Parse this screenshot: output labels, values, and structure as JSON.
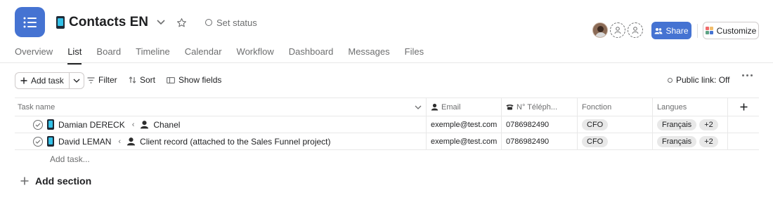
{
  "header": {
    "project_title": "Contacts EN",
    "set_status": "Set status",
    "share_label": "Share",
    "customize_label": "Customize",
    "accent_color": "#4573d2"
  },
  "tabs": [
    {
      "label": "Overview",
      "active": false
    },
    {
      "label": "List",
      "active": true
    },
    {
      "label": "Board",
      "active": false
    },
    {
      "label": "Timeline",
      "active": false
    },
    {
      "label": "Calendar",
      "active": false
    },
    {
      "label": "Workflow",
      "active": false
    },
    {
      "label": "Dashboard",
      "active": false
    },
    {
      "label": "Messages",
      "active": false
    },
    {
      "label": "Files",
      "active": false
    }
  ],
  "toolbar": {
    "add_task": "Add task",
    "filter": "Filter",
    "sort": "Sort",
    "show_fields": "Show fields",
    "public_link": "Public link: Off"
  },
  "table": {
    "columns": [
      "Task name",
      "Email",
      "N° Téléph...",
      "Fonction",
      "Langues"
    ],
    "rows": [
      {
        "name": "Damian DERECK",
        "parent": "Chanel",
        "email": "exemple@test.com",
        "phone": "0786982490",
        "fonction": "CFO",
        "langue": "Français",
        "more_langues": "+2"
      },
      {
        "name": "David LEMAN",
        "parent": "Client record (attached to the Sales Funnel project)",
        "email": "exemple@test.com",
        "phone": "0786982490",
        "fonction": "CFO",
        "langue": "Français",
        "more_langues": "+2"
      }
    ],
    "add_task_row": "Add task..."
  },
  "add_section": "Add section",
  "icons": [
    "list-icon",
    "chevron-down-icon",
    "star-icon",
    "status-circle-icon",
    "person-icon",
    "phone-icon",
    "plus-icon",
    "filter-icon",
    "sort-icon",
    "show-fields-icon",
    "more-icon",
    "check-circle-icon"
  ]
}
